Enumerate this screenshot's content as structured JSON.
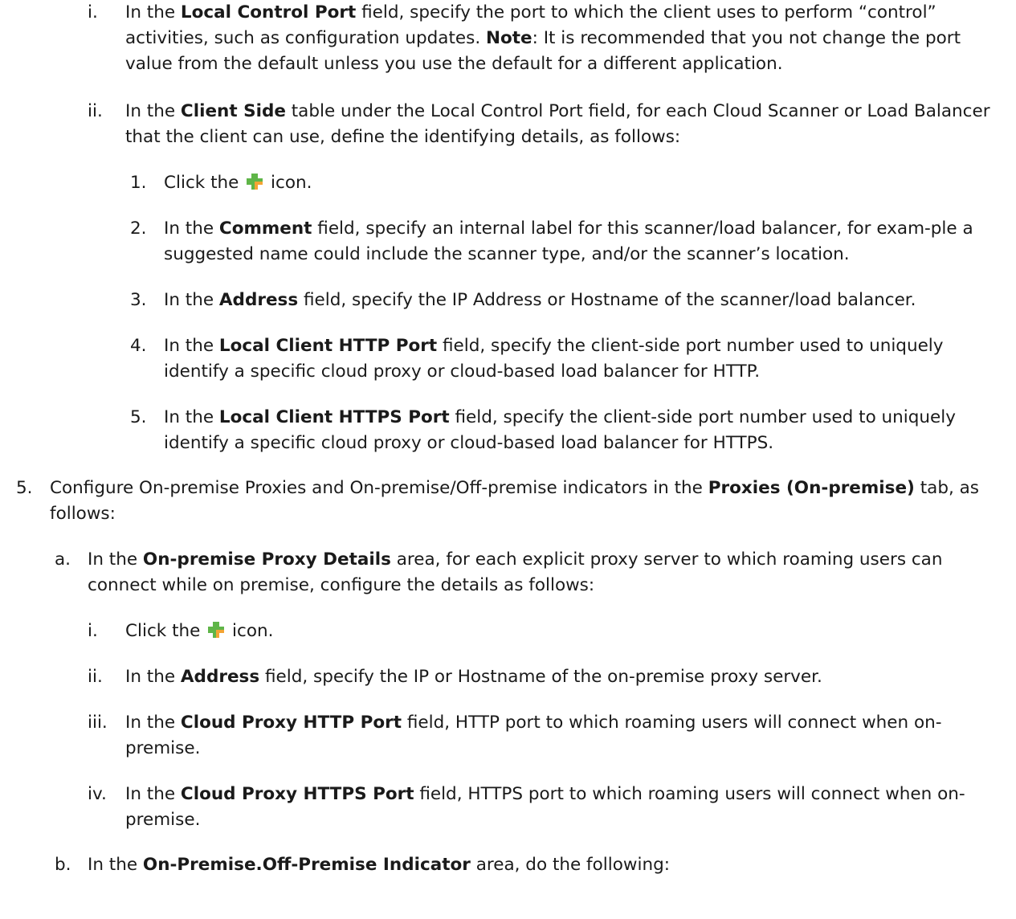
{
  "items": [
    {
      "num": "i.",
      "pre": "In the ",
      "bold": "Local Control Port",
      "post": " field, specify the port to which the client uses to perform “control” activities, such as configuration updates. ",
      "bold2": "Note",
      "post2": ": It is recommended that you not change the port value from the default unless you use the default for a different application."
    },
    {
      "num": "ii.",
      "pre": "In the ",
      "bold": "Client Side",
      "post": " table under the Local Control Port field, for each Cloud Scanner or Load Balancer that the client can use, define the identifying details, as follows:"
    },
    {
      "num": "1.",
      "pre": "Click the ",
      "icon": "add-plus-icon",
      "post": " icon."
    },
    {
      "num": "2.",
      "pre": "In the ",
      "bold": "Comment",
      "post": " field, specify an internal label for this scanner/load balancer, for exam-ple a suggested name could include the scanner type, and/or the scanner’s location."
    },
    {
      "num": "3.",
      "pre": "In the ",
      "bold": "Address",
      "post": " field, specify the IP Address or Hostname of the scanner/load balancer."
    },
    {
      "num": "4.",
      "pre": "In the ",
      "bold": "Local Client HTTP Port",
      "post": " field, specify the client-side port number used to uniquely identify a specific cloud proxy or cloud-based load balancer for HTTP."
    },
    {
      "num": "5.",
      "pre": "In the ",
      "bold": "Local Client HTTPS Port",
      "post": " field, specify the client-side port number used to uniquely identify a specific cloud proxy or cloud-based load balancer for HTTPS."
    },
    {
      "num": "5.",
      "pre": "Configure On-premise Proxies and On-premise/Off-premise indicators in the ",
      "bold": "Proxies (On-premise)",
      "post": " tab, as follows:"
    },
    {
      "num": "a.",
      "pre": "In the ",
      "bold": "On-premise Proxy Details",
      "post": " area, for each explicit proxy server to which roaming users can connect while on premise, configure the details as follows:"
    },
    {
      "num": "i.",
      "pre": "Click the ",
      "icon": "add-plus-icon",
      "post": " icon."
    },
    {
      "num": "ii.",
      "pre": "In the ",
      "bold": "Address",
      "post": " field, specify the IP or Hostname of the on-premise proxy server."
    },
    {
      "num": "iii.",
      "pre": "In the ",
      "bold": "Cloud Proxy HTTP Port",
      "post": " field, HTTP port to which roaming users will connect when on-premise."
    },
    {
      "num": "iv.",
      "pre": "In the ",
      "bold": "Cloud Proxy HTTPS Port",
      "post": " field, HTTPS port to which roaming users will connect when on-premise."
    },
    {
      "num": "b.",
      "pre": "In the ",
      "bold": "On-Premise.Off-Premise Indicator",
      "post": " area, do the following:"
    }
  ],
  "colors": {
    "text": "#1a1a1a",
    "icon_green": "#5fb548",
    "icon_orange": "#f3a433"
  }
}
